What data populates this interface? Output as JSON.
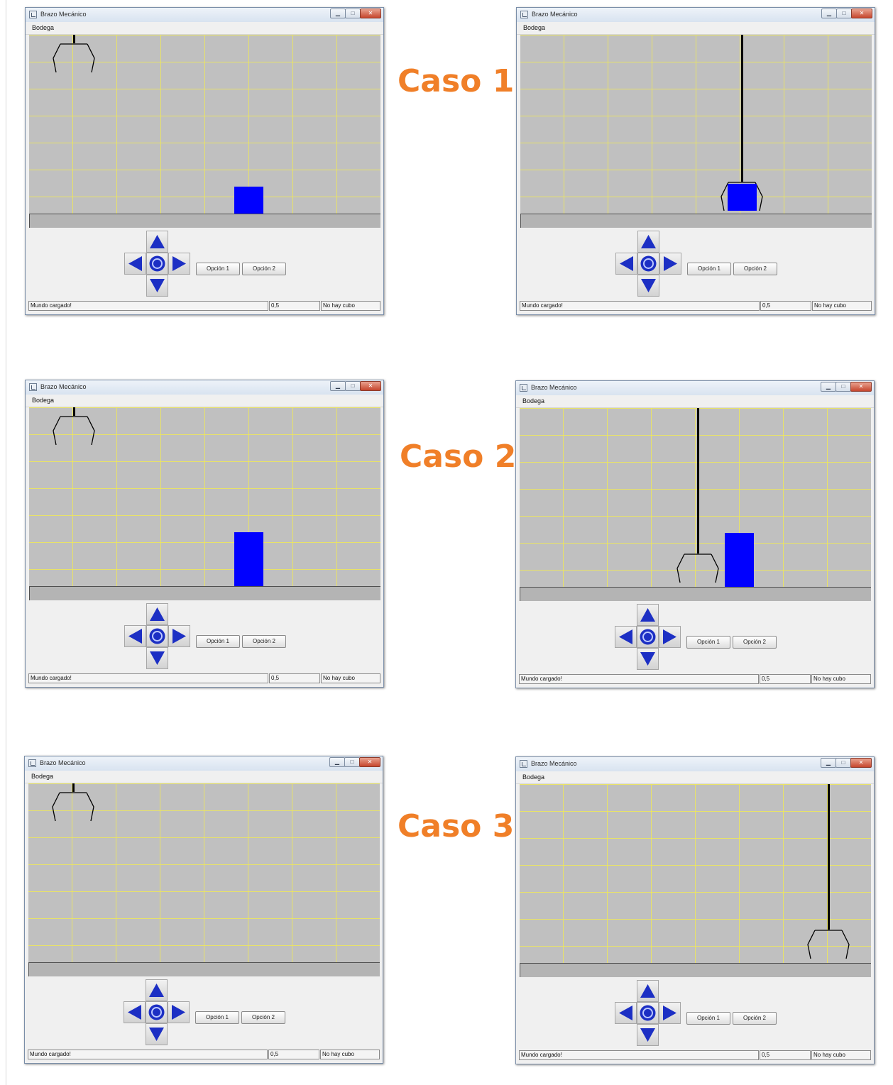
{
  "window": {
    "title": "Brazo Mecánico",
    "menu": "Bodega",
    "option1_label": "Opción 1",
    "option2_label": "Opción 2",
    "status_message": "Mundo cargado!",
    "status_value": "0,5",
    "status_cube": "No hay cubo"
  },
  "cases": [
    {
      "label": "Caso 1"
    },
    {
      "label": "Caso 2"
    },
    {
      "label": "Caso 3"
    }
  ],
  "icons": {
    "arrow_up": "arrow-up-icon",
    "arrow_down": "arrow-down-icon",
    "arrow_left": "arrow-left-icon",
    "arrow_right": "arrow-right-icon",
    "center": "target-icon"
  },
  "colors": {
    "case_label": "#f07f28",
    "cube": "#0000ff",
    "grid_line": "#eee858",
    "world_background": "#c0c0c0",
    "dpad_blue": "#1c2fc4"
  }
}
